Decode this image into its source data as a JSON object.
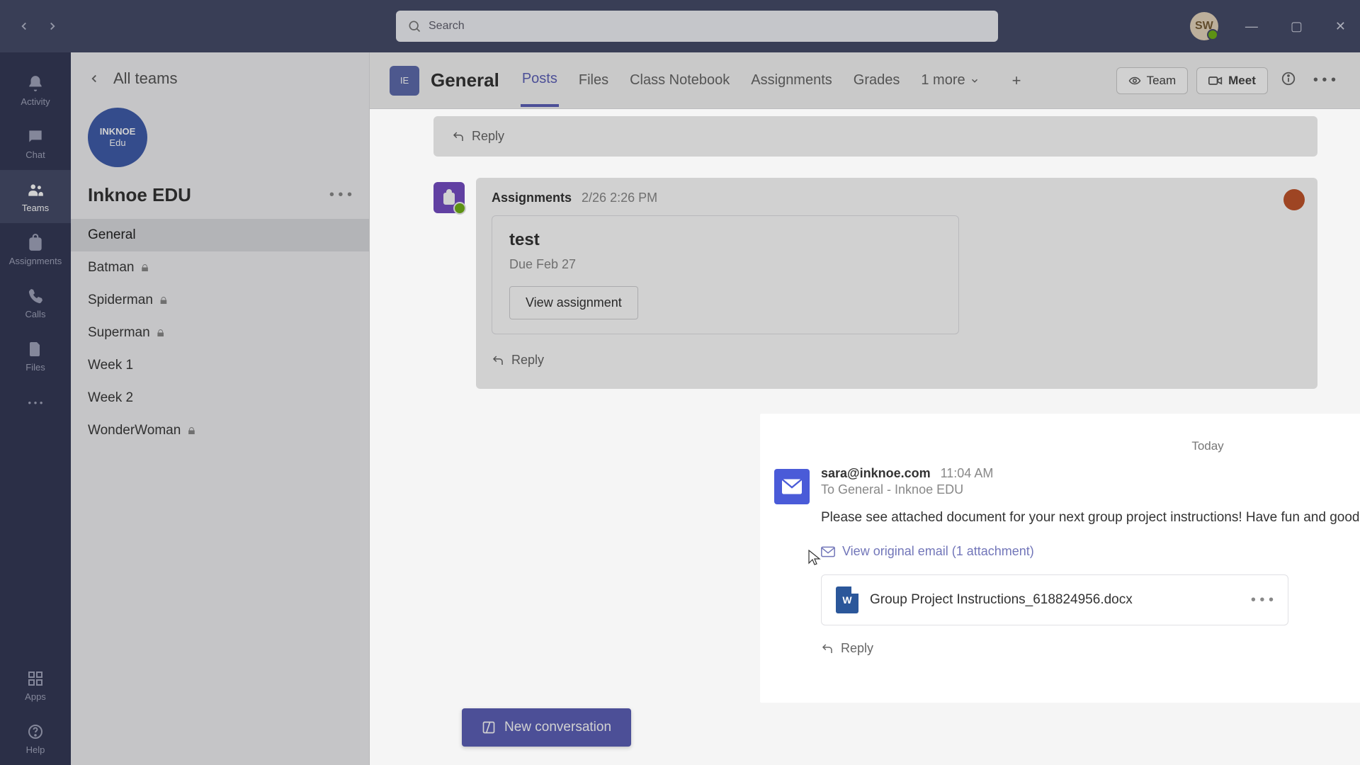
{
  "titlebar": {
    "search_placeholder": "Search",
    "user_initials": "SW"
  },
  "rail": {
    "items": [
      {
        "id": "activity",
        "label": "Activity"
      },
      {
        "id": "chat",
        "label": "Chat"
      },
      {
        "id": "teams",
        "label": "Teams"
      },
      {
        "id": "assignments",
        "label": "Assignments"
      },
      {
        "id": "calls",
        "label": "Calls"
      },
      {
        "id": "files",
        "label": "Files"
      }
    ],
    "apps_label": "Apps",
    "help_label": "Help"
  },
  "sidebar": {
    "all_teams": "All teams",
    "team_logo_line1": "INKNOE",
    "team_logo_line2": "Edu",
    "team_name": "Inknoe EDU",
    "channels": [
      {
        "label": "General",
        "locked": false,
        "active": true
      },
      {
        "label": "Batman",
        "locked": true
      },
      {
        "label": "Spiderman",
        "locked": true
      },
      {
        "label": "Superman",
        "locked": true
      },
      {
        "label": "Week 1",
        "locked": false
      },
      {
        "label": "Week 2",
        "locked": false
      },
      {
        "label": "WonderWoman",
        "locked": true
      }
    ]
  },
  "header": {
    "channel_title": "General",
    "tabs": [
      {
        "label": "Posts",
        "active": true
      },
      {
        "label": "Files"
      },
      {
        "label": "Class Notebook"
      },
      {
        "label": "Assignments"
      },
      {
        "label": "Grades"
      }
    ],
    "more_tab": "1 more",
    "team_btn": "Team",
    "meet_btn": "Meet"
  },
  "feed": {
    "reply_label": "Reply",
    "assignment": {
      "sender": "Assignments",
      "time": "2/26 2:26 PM",
      "title": "test",
      "due": "Due Feb 27",
      "button": "View assignment"
    },
    "day_separator": "Today",
    "email": {
      "from": "sara@inknoe.com",
      "time": "11:04 AM",
      "to": "To General - Inknoe EDU",
      "body": "Please see attached document for your next group project instructions! Have fun and good luck!",
      "view_original": "View original email (1 attachment)",
      "attachment_name": "Group Project Instructions_618824956.docx"
    },
    "new_conversation": "New conversation"
  }
}
